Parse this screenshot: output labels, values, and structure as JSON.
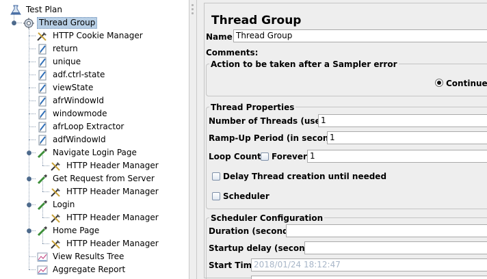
{
  "tree": {
    "test_plan": "Test Plan",
    "thread_group": "Thread Group",
    "children": [
      {
        "label": "HTTP Cookie Manager",
        "icon": "cookie-tool-icon"
      },
      {
        "label": "return",
        "icon": "extractor-icon"
      },
      {
        "label": "unique",
        "icon": "extractor-icon"
      },
      {
        "label": "adf.ctrl-state",
        "icon": "extractor-icon"
      },
      {
        "label": "viewState",
        "icon": "extractor-icon"
      },
      {
        "label": "afrWindowId",
        "icon": "extractor-icon"
      },
      {
        "label": "windowmode",
        "icon": "extractor-icon"
      },
      {
        "label": "afrLoop Extractor",
        "icon": "extractor-icon"
      },
      {
        "label": "adfWindowId",
        "icon": "extractor-icon"
      },
      {
        "label": "Navigate Login Page",
        "icon": "sampler-pipette-icon"
      },
      {
        "label": "HTTP Header Manager",
        "icon": "header-tool-icon"
      },
      {
        "label": "Get Request from Server",
        "icon": "sampler-pipette-icon"
      },
      {
        "label": "HTTP Header Manager",
        "icon": "header-tool-icon"
      },
      {
        "label": "Login",
        "icon": "sampler-pipette-icon"
      },
      {
        "label": "HTTP Header Manager",
        "icon": "header-tool-icon"
      },
      {
        "label": "Home Page",
        "icon": "sampler-pipette-icon"
      },
      {
        "label": "HTTP Header Manager",
        "icon": "header-tool-icon"
      },
      {
        "label": "View Results Tree",
        "icon": "listener-graph-icon"
      },
      {
        "label": "Aggregate Report",
        "icon": "listener-graph-icon"
      }
    ]
  },
  "panel": {
    "title": "Thread Group",
    "name_label": "Name:",
    "name_value": "Thread Group",
    "comments_label": "Comments:",
    "sampler_error": {
      "legend": "Action to be taken after a Sampler error",
      "option_label": "Continue"
    },
    "thread_props": {
      "legend": "Thread Properties",
      "threads_label": "Number of Threads (users):",
      "threads_value": "1",
      "rampup_label": "Ramp-Up Period (in seconds):",
      "rampup_value": "1",
      "loop_label": "Loop Count:",
      "forever_label": "Forever",
      "loop_value": "1",
      "delay_label": "Delay Thread creation until needed",
      "scheduler_label": "Scheduler"
    },
    "scheduler_config": {
      "legend": "Scheduler Configuration",
      "duration_label": "Duration (seconds)",
      "duration_value": "",
      "startup_label": "Startup delay (seconds)",
      "startup_value": "",
      "start_time_label": "Start Time",
      "start_time_value": "2018/01/24 18:12:47"
    }
  },
  "colors": {
    "selection": "#b8cfe5",
    "panel_bg": "#eeeeee",
    "disabled_text": "#a8b6c8"
  }
}
